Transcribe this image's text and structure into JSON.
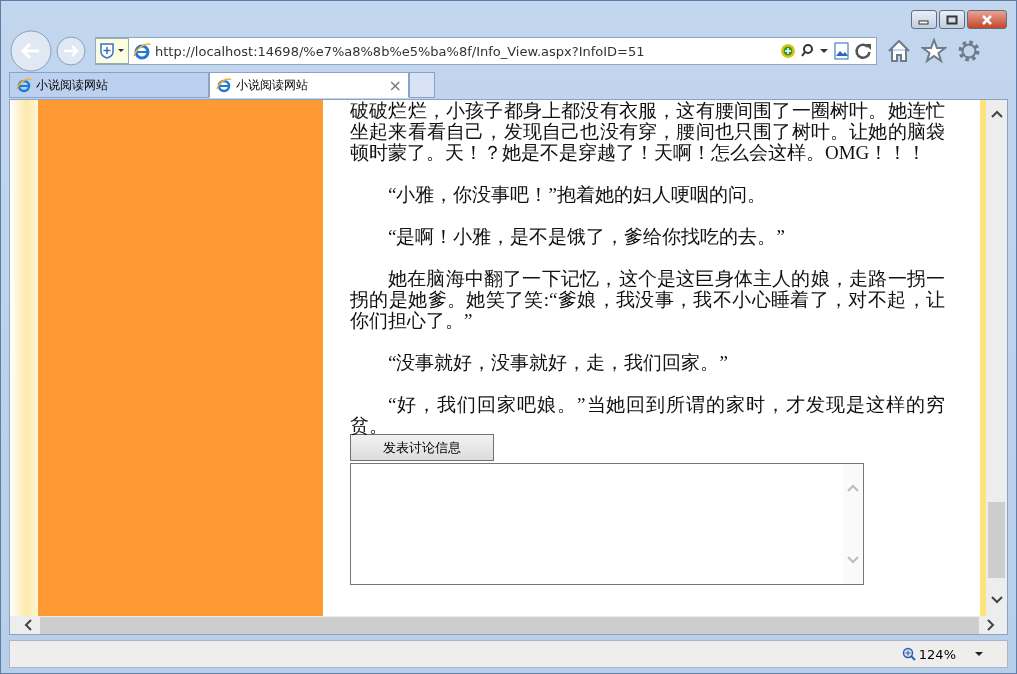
{
  "address_bar": {
    "url": "http://localhost:14698/%e7%a8%8b%e5%ba%8f/Info_View.aspx?InfoID=51"
  },
  "tabs": [
    {
      "label": "小说阅读网站",
      "selected": false
    },
    {
      "label": "小说阅读网站",
      "selected": true,
      "close": "×"
    }
  ],
  "article": {
    "paragraphs": [
      {
        "text": "破破烂烂，小孩子都身上都没有衣服，这有腰间围了一圈树叶。她连忙坐起来看看自己，发现自己也没有穿，腰间也只围了树叶。让她的脑袋顿时蒙了。天！？她是不是穿越了！天啊！怎么会这样。OMG！！！",
        "indent": false
      },
      {
        "text": "“小雅，你没事吧！”抱着她的妇人哽咽的问。",
        "indent": true
      },
      {
        "text": "“是啊！小雅，是不是饿了，爹给你找吃的去。”",
        "indent": true
      },
      {
        "text": "她在脑海中翻了一下记忆，这个是这巨身体主人的娘，走路一拐一拐的是她爹。她笑了笑:“爹娘，我没事，我不小心睡着了，对不起，让你们担心了。”",
        "indent": true
      },
      {
        "text": "“没事就好，没事就好，走，我们回家。”",
        "indent": true
      },
      {
        "text": "“好，我们回家吧娘。”当她回到所谓的家时，才发现是这样的穷贫。",
        "indent": true
      }
    ],
    "post_button": "发表讨论信息"
  },
  "status_bar": {
    "zoom": "124%"
  }
}
